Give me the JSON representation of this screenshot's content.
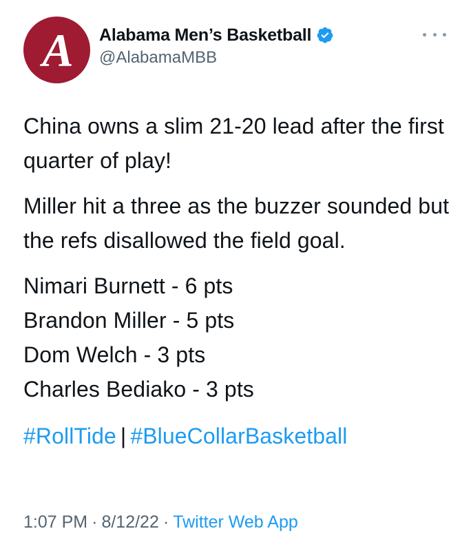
{
  "account": {
    "display_name": "Alabama Men’s Basketball",
    "handle": "@AlabamaMBB",
    "verified": true,
    "avatar_letter": "A",
    "avatar_color": "#9e1b32"
  },
  "tweet": {
    "paragraph_1": "China owns a slim 21-20 lead after the first quarter of play!",
    "paragraph_2": "Miller hit a three as the buzzer sounded but the refs disallowed the field goal.",
    "stats": [
      "Nimari Burnett - 6 pts",
      "Brandon Miller - 5 pts",
      "Dom Welch - 3 pts",
      "Charles Bediako - 3 pts"
    ],
    "hashtags": [
      "#RollTide",
      "#BlueCollarBasketball"
    ],
    "hashtag_separator": "|"
  },
  "meta": {
    "time": "1:07 PM",
    "date": "8/12/22",
    "separator": "·",
    "source": "Twitter Web App"
  },
  "colors": {
    "link": "#1d9bf0",
    "secondary_text": "#536471",
    "primary_text": "#0f1419"
  },
  "icons": {
    "verified": "verified-badge-icon",
    "more": "more-options-icon"
  }
}
